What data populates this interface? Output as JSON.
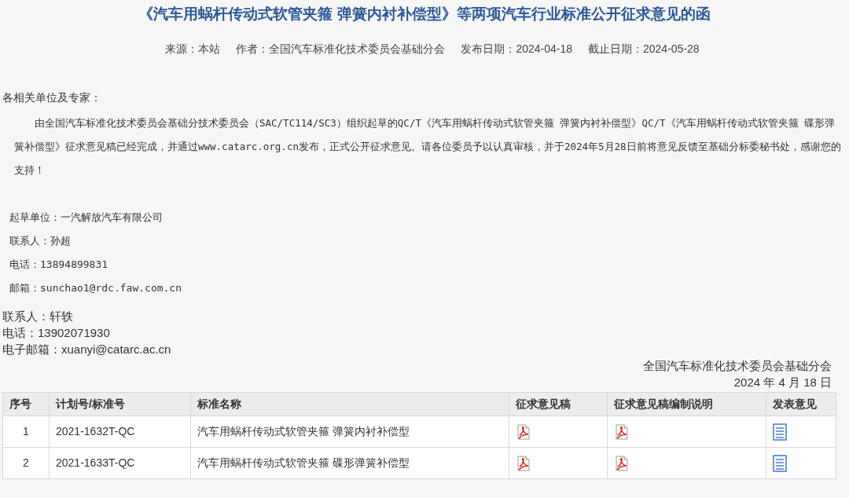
{
  "title": "《汽车用蜗杆传动式软管夹箍 弹簧内衬补偿型》等两项汽车行业标准公开征求意见的函",
  "meta": [
    "来源：本站",
    "作者：全国汽车标准化技术委员会基础分会",
    "发布日期：2024-04-18",
    "截止日期：2024-05-28"
  ],
  "greeting": "各相关单位及专家：",
  "body": "由全国汽车标准化技术委员会基础分技术委员会（SAC/TC114/SC3）组织起草的QC/T《汽车用蜗杆传动式软管夹箍 弹簧内衬补偿型》QC/T《汽车用蜗杆传动式软管夹箍 碟形弹簧补偿型》征求意见稿已经完成，并通过www.catarc.org.cn发布，正式公开征求意见。请各位委员予以认真审核，并于2024年5月28日前将意见反馈至基础分标委秘书处，感谢您的支持！",
  "drafter_info": [
    "起草单位：一汽解放汽车有限公司",
    "联系人：孙超",
    "电话：13894899831",
    "邮箱：sunchao1@rdc.faw.com.cn"
  ],
  "contact_info": [
    "联系人：轩轶",
    "电话：13902071930",
    "电子邮箱：xuanyi@catarc.ac.cn"
  ],
  "signature": [
    "全国汽车标准化技术委员会基础分会",
    "2024 年 4 月 18 日"
  ],
  "table": {
    "columns": [
      "序号",
      "计划号/标准号",
      "标准名称",
      "征求意见稿",
      "征求意见稿编制说明",
      "发表意见"
    ],
    "rows": [
      {
        "index": "1",
        "plan_no": "2021-1632T-QC",
        "name": "汽车用蜗杆传动式软管夹箍 弹簧内衬补偿型"
      },
      {
        "index": "2",
        "plan_no": "2021-1633T-QC",
        "name": "汽车用蜗杆传动式软管夹箍 碟形弹簧补偿型"
      }
    ]
  }
}
